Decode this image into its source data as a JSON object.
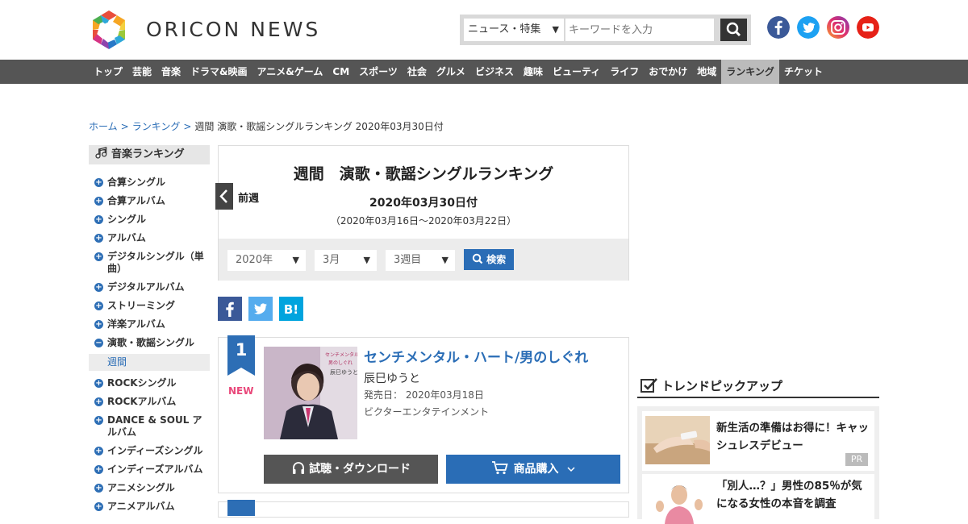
{
  "header": {
    "logo_text": "ORICON NEWS",
    "search": {
      "category": "ニュース・特集",
      "placeholder": "キーワードを入力"
    },
    "sns": [
      "facebook-icon",
      "twitter-icon",
      "instagram-icon",
      "youtube-icon"
    ]
  },
  "nav": [
    "トップ",
    "芸能",
    "音楽",
    "ドラマ&映画",
    "アニメ&ゲーム",
    "CM",
    "スポーツ",
    "社会",
    "グルメ",
    "ビジネス",
    "趣味",
    "ビューティ",
    "ライフ",
    "おでかけ",
    "地域",
    "ランキング",
    "チケット"
  ],
  "breadcrumb": {
    "home": "ホーム",
    "ranking": "ランキング",
    "current": "週間 演歌・歌謡シングルランキング 2020年03月30日付"
  },
  "sidebar": {
    "title": "音楽ランキング",
    "items": [
      "合算シングル",
      "合算アルバム",
      "シングル",
      "アルバム",
      "デジタルシングル（単曲）",
      "デジタルアルバム",
      "ストリーミング",
      "洋楽アルバム",
      "演歌・歌謡シングル",
      "ROCKシングル",
      "ROCKアルバム",
      "DANCE & SOUL アルバム",
      "インディーズシングル",
      "インディーズアルバム",
      "アニメシングル",
      "アニメアルバム"
    ],
    "sub": "週間"
  },
  "main": {
    "title": "週間　演歌・歌謡シングルランキング",
    "date": "2020年03月30日付",
    "range": "（2020年03月16日～2020年03月22日）",
    "prev": "前週",
    "year": "2020年",
    "month": "3月",
    "week": "3週目",
    "search_btn": "検索"
  },
  "entry": {
    "rank": "1",
    "badge": "NEW",
    "title": "センチメンタル・ハート/男のしぐれ",
    "artist": "辰巳ゆうと",
    "release_label": "発売日：",
    "release_date": "2020年03月18日",
    "label": "ビクターエンタテインメント",
    "listen_btn": "試聴・ダウンロード",
    "buy_btn": "商品購入",
    "jacket_text": "センチメンタル・ハート 男のしぐれ 辰巳ゆうと"
  },
  "trend": {
    "title": "トレンドピックアップ",
    "cards": [
      {
        "text": "新生活の準備はお得に！キャッシュレスデビュー",
        "badge": "PR"
      },
      {
        "text": "「別人…？」男性の85％が気になる女性の本音を調査"
      }
    ]
  },
  "colors": {
    "accent": "#2a6db6",
    "nav_bg": "#555555",
    "new_badge": "#e9487a"
  }
}
